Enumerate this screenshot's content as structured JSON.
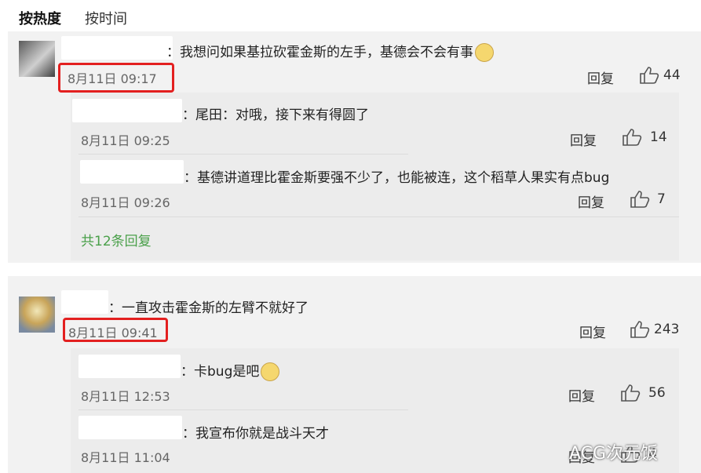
{
  "tabs": {
    "hot": "按热度",
    "time": "按时间"
  },
  "comments": [
    {
      "text": "：我想问如果基拉砍霍金斯的左手，基德会不会有事",
      "time": "8月11日 09:17",
      "reply": "回复",
      "likes": "44",
      "replies": [
        {
          "text": "：尾田：对哦，接下来有得圆了",
          "time": "8月11日 09:25",
          "reply": "回复",
          "likes": "14"
        },
        {
          "text": "：基德讲道理比霍金斯要强不少了，也能被连，这个稻草人果实有点bug",
          "time": "8月11日 09:26",
          "reply": "回复",
          "likes": "7"
        }
      ],
      "more": "共12条回复"
    },
    {
      "text": "：一直攻击霍金斯的左臂不就好了",
      "time": "8月11日 09:41",
      "reply": "回复",
      "likes": "243",
      "replies": [
        {
          "text": "：卡bug是吧",
          "time": "8月11日 12:53",
          "reply": "回复",
          "likes": "56"
        },
        {
          "text": "：我宣布你就是战斗天才",
          "time": "8月11日 11:04",
          "reply": "回复",
          "likes": "4"
        }
      ]
    }
  ],
  "watermark": "ACG次元饭",
  "colors": {
    "highlight": "#e32020",
    "more_link": "#4aa04a",
    "card_bg": "#f2f2f2"
  }
}
